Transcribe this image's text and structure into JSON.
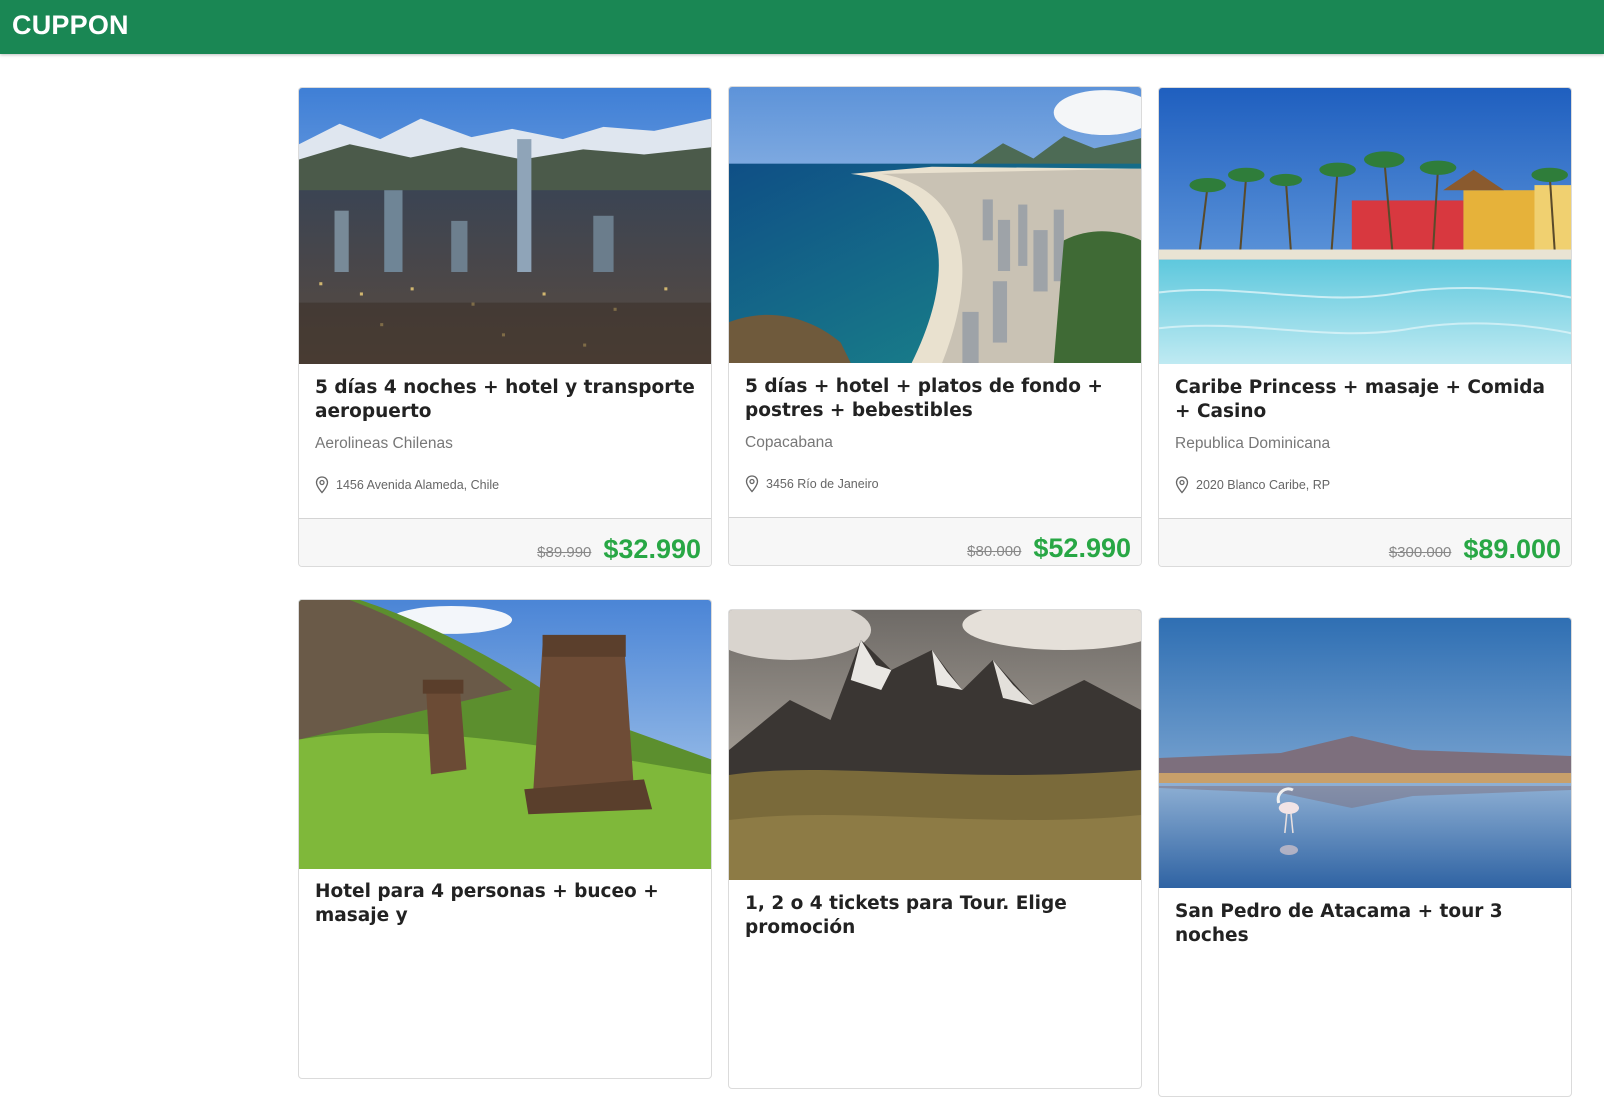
{
  "header": {
    "brand": "CUPPON"
  },
  "deals": [
    {
      "title": "5 días 4 noches + hotel y transporte aeropuerto",
      "subtitle": "Aerolineas Chilenas",
      "address": "1456 Avenida Alameda, Chile",
      "old_price": "$89.990",
      "price": "$32.990"
    },
    {
      "title": "5 días + hotel + platos de fondo + postres + bebestibles",
      "subtitle": "Copacabana",
      "address": "3456 Río de Janeiro",
      "old_price": "$80.000",
      "price": "$52.990"
    },
    {
      "title": "Caribe Princess + masaje + Comida + Casino",
      "subtitle": "Republica Dominicana",
      "address": "2020 Blanco Caribe, RP",
      "old_price": "$300.000",
      "price": "$89.000"
    },
    {
      "title": "Hotel para 4 personas + buceo + masaje y",
      "subtitle": "",
      "address": "",
      "old_price": "",
      "price": ""
    },
    {
      "title": "1, 2 o 4 tickets para Tour. Elige promoción",
      "subtitle": "",
      "address": "",
      "old_price": "",
      "price": ""
    },
    {
      "title": "San Pedro de Atacama + tour 3 noches",
      "subtitle": "",
      "address": "",
      "old_price": "",
      "price": ""
    }
  ],
  "icons": {
    "address": "map-pin-icon"
  },
  "colors": {
    "header_bg": "#1a8754",
    "price": "#28a745",
    "old_price": "#888888"
  }
}
